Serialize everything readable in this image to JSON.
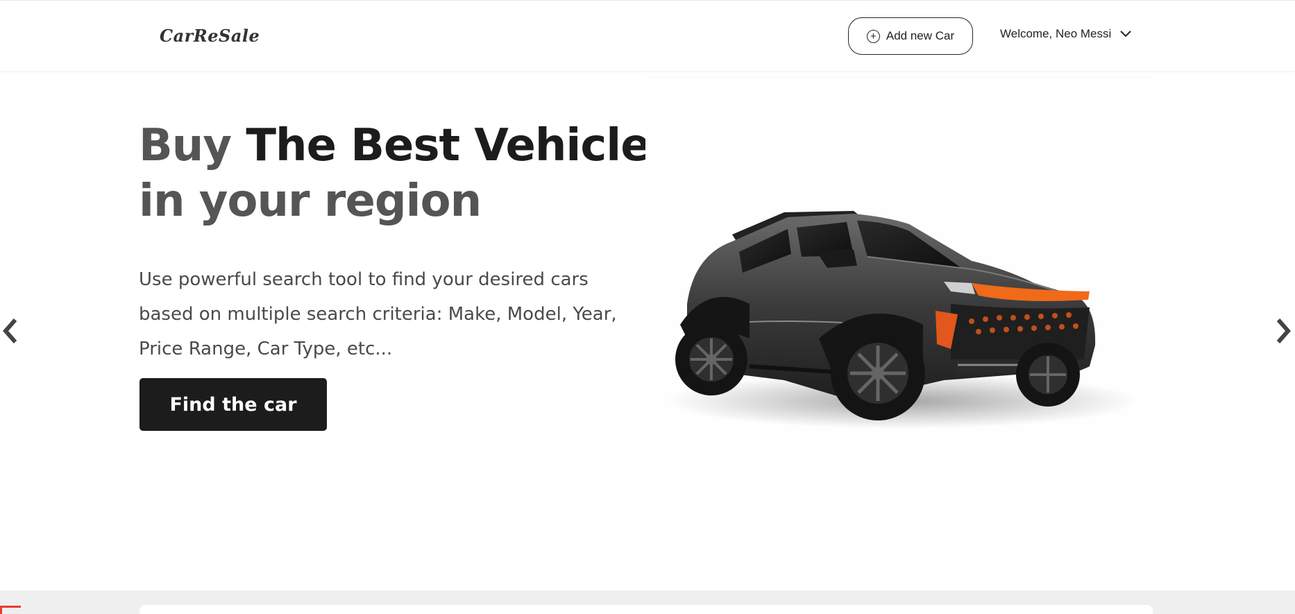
{
  "header": {
    "logo": "CarReSale",
    "add_button_label": "Add new Car",
    "welcome_text": "Welcome, Neo Messi"
  },
  "hero": {
    "title_part1": "Buy",
    "title_part2": "The Best Vehicles",
    "title_line2": "in your region",
    "description": "Use powerful search tool to find your desired cars based on multiple search criteria: Make, Model, Year, Price Range, Car Type, etc...",
    "cta_label": "Find the car"
  },
  "icons": {
    "add": "plus-circle-icon",
    "dropdown": "chevron-down-icon",
    "prev": "chevron-left-icon",
    "next": "chevron-right-icon"
  },
  "colors": {
    "primary_dark": "#1c1c1c",
    "text_muted": "#555555",
    "accent_red": "#e53e2e",
    "band_gray": "#efefef"
  }
}
